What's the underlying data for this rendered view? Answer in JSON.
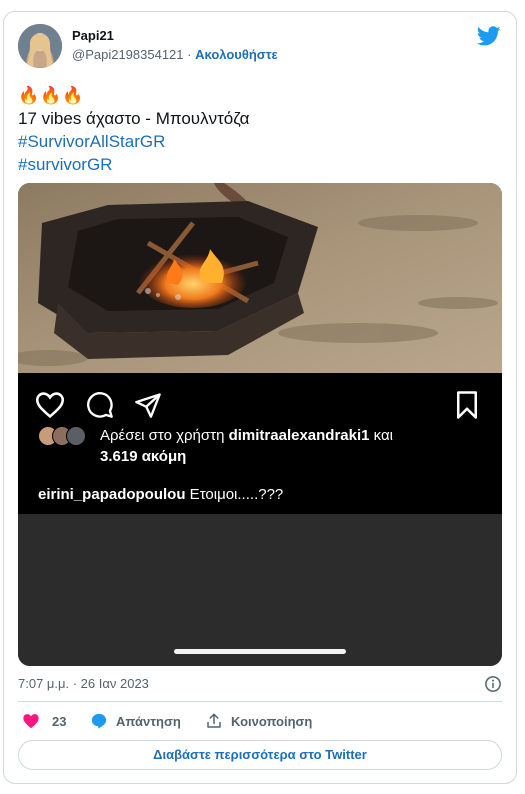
{
  "author": {
    "name": "Papi21",
    "handle": "@Papi2198354121",
    "separator": "·",
    "follow_label": "Ακολουθήστε"
  },
  "tweet": {
    "emoji_line": "🔥🔥🔥",
    "text": "17 vibes άχαστο - Μπουλντόζα",
    "hashtags": [
      "#SurvivorAllStarGR",
      "#survivorGR"
    ]
  },
  "media": {
    "likes_prefix": "Αρέσει στο χρήστη ",
    "likes_user": "dimitraalexandraki1",
    "likes_middle": " και",
    "likes_count": "3.619 ακόμη",
    "comment_user": "eirini_papadopoulou",
    "comment_text": " Ετοιμοι.....???"
  },
  "meta": {
    "timestamp": "7:07 μ.μ. · 26 Ιαν 2023"
  },
  "actions": {
    "like_count": "23",
    "reply_label": "Απάντηση",
    "share_label": "Κοινοποίηση"
  },
  "footer": {
    "read_more_label": "Διαβάστε περισσότερα στο Twitter"
  },
  "colors": {
    "link": "#1d6fb8",
    "twitter_blue": "#1d9bf0",
    "heart": "#f91880",
    "muted": "#536471"
  },
  "icons": [
    "twitter-bird-icon",
    "heart-icon",
    "comment-icon",
    "send-icon",
    "bookmark-icon",
    "info-icon",
    "reply-icon",
    "share-icon"
  ]
}
